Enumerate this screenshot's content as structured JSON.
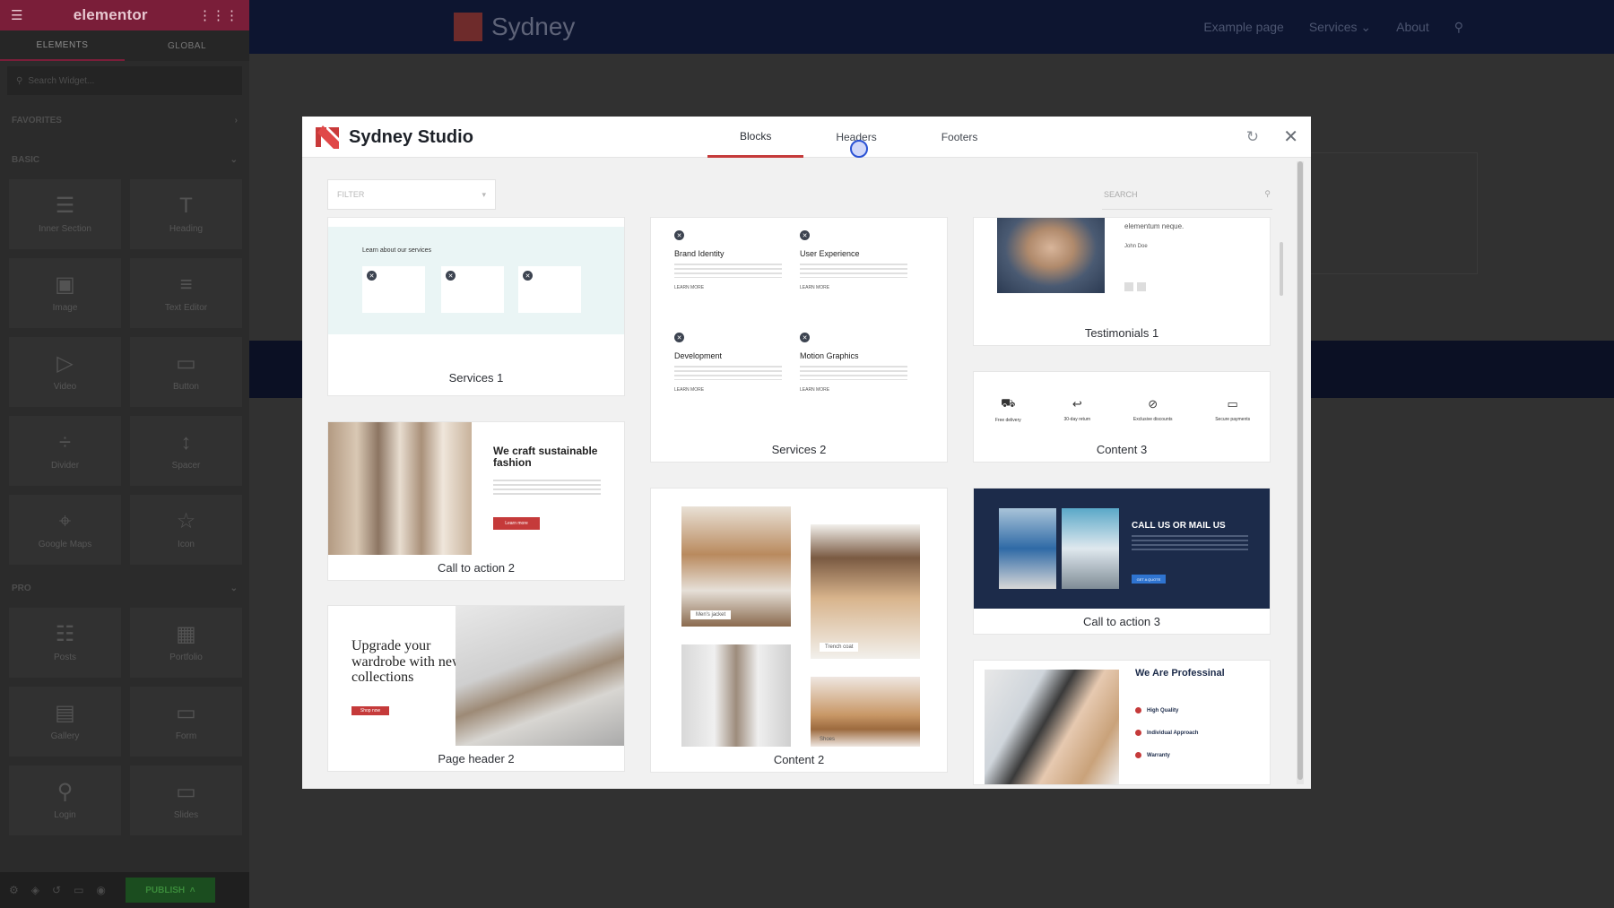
{
  "sidebar": {
    "app_name": "elementor",
    "tabs": [
      "ELEMENTS",
      "GLOBAL"
    ],
    "search_placeholder": "Search Widget...",
    "categories": [
      "FAVORITES",
      "BASIC",
      "PRO"
    ],
    "basic_widgets": [
      {
        "label": "Inner Section",
        "icon": "inner-section-icon",
        "glyph": "☰"
      },
      {
        "label": "Heading",
        "icon": "heading-icon",
        "glyph": "T"
      },
      {
        "label": "Image",
        "icon": "image-icon",
        "glyph": "▣"
      },
      {
        "label": "Text Editor",
        "icon": "text-editor-icon",
        "glyph": "≡"
      },
      {
        "label": "Video",
        "icon": "video-icon",
        "glyph": "▷"
      },
      {
        "label": "Button",
        "icon": "button-icon",
        "glyph": "▭"
      },
      {
        "label": "Divider",
        "icon": "divider-icon",
        "glyph": "÷"
      },
      {
        "label": "Spacer",
        "icon": "spacer-icon",
        "glyph": "↕"
      },
      {
        "label": "Google Maps",
        "icon": "map-icon",
        "glyph": "⌖"
      },
      {
        "label": "Icon",
        "icon": "star-icon",
        "glyph": "☆"
      }
    ],
    "pro_widgets": [
      {
        "label": "Posts",
        "icon": "posts-icon",
        "glyph": "☷"
      },
      {
        "label": "Portfolio",
        "icon": "portfolio-icon",
        "glyph": "▦"
      },
      {
        "label": "Gallery",
        "icon": "gallery-icon",
        "glyph": "▤"
      },
      {
        "label": "Form",
        "icon": "form-icon",
        "glyph": "▭"
      },
      {
        "label": "Login",
        "icon": "login-icon",
        "glyph": "⚲"
      },
      {
        "label": "Slides",
        "icon": "slides-icon",
        "glyph": "▭"
      }
    ],
    "publish_label": "PUBLISH"
  },
  "site": {
    "brand": "Sydney",
    "nav": [
      "Example page",
      "Services",
      "About"
    ]
  },
  "modal": {
    "title": "Sydney Studio",
    "tabs": [
      "Blocks",
      "Headers",
      "Footers"
    ],
    "active_tab": "Blocks",
    "filter_placeholder": "FILTER",
    "search_placeholder": "SEARCH",
    "colors": {
      "accent": "#c53a3a",
      "navy": "#1c2b4a"
    }
  },
  "cards": {
    "services1": {
      "label": "Services 1",
      "heading": "Learn about our services"
    },
    "services2": {
      "label": "Services 2",
      "items": [
        "Brand Identity",
        "User Experience",
        "Development",
        "Motion Graphics"
      ],
      "link": "LEARN MORE"
    },
    "testimonials1": {
      "label": "Testimonials 1",
      "quote": "elementum neque.",
      "author": "John Doe"
    },
    "content3": {
      "label": "Content 3",
      "features": [
        "Free delivery",
        "30-day return",
        "Exclusive discounts",
        "Secure payments"
      ]
    },
    "cta2": {
      "label": "Call to action 2",
      "heading": "We craft sustainable fashion",
      "button": "Learn more"
    },
    "content2": {
      "label": "Content 2",
      "captions": [
        "Men's jacket",
        "Trench coat",
        "Shoes"
      ]
    },
    "cta3": {
      "label": "Call to action 3",
      "heading": "CALL US OR MAIL US",
      "button": "GET A QUOTE"
    },
    "pageheader2": {
      "label": "Page header 2",
      "heading": "Upgrade your wardrobe with new collections",
      "button": "Shop now"
    },
    "professional": {
      "heading": "We Are Professinal",
      "points": [
        "High Quality",
        "Individual Approach",
        "Warranty"
      ]
    }
  }
}
